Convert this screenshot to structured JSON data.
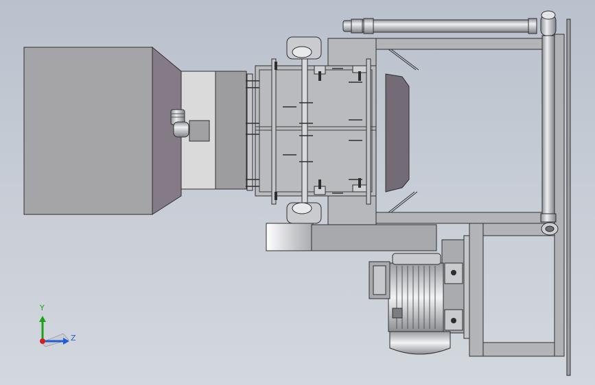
{
  "viewport": {
    "background_top": "#b9c1cc",
    "background_bottom": "#d3d7de",
    "model_edge_color": "#3a3a3a",
    "housing_color": "#b4b6bb",
    "hopper_side_color": "#8a7f88",
    "transition_color": "#d8d8d8",
    "pipe_color": "#c7c9cd"
  },
  "triad": {
    "y_label": "Y",
    "z_label": "Z",
    "y_axis_color": "#1aa31a",
    "z_axis_color": "#1f5fd6",
    "origin_color": "#d21f1f"
  }
}
